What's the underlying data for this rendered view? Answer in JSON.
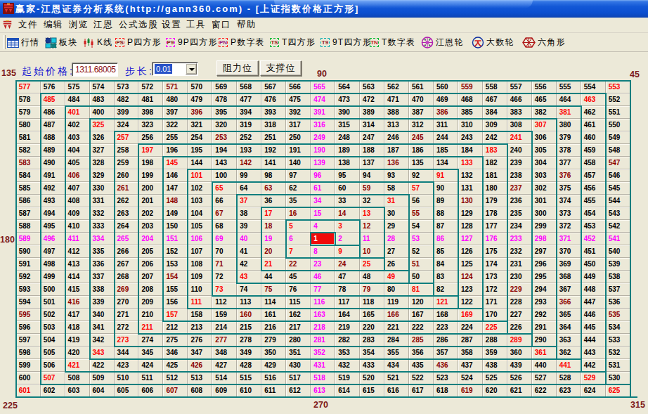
{
  "window": {
    "title": "赢家-江恩证券分析系统(http://gann360.com) - [上证指数价格正方形]"
  },
  "menu": {
    "items": [
      "文件",
      "编辑",
      "浏览",
      "江恩",
      "公式选股",
      "设置",
      "工具",
      "窗口",
      "帮助"
    ]
  },
  "toolbar": {
    "items": [
      {
        "icon": "quotes-grid-icon",
        "label": "行情"
      },
      {
        "icon": "blocks-icon",
        "label": "板块"
      },
      {
        "icon": "candlestick-icon",
        "label": "K线"
      },
      {
        "icon": "ps-badge-icon",
        "badge": "PS",
        "label": "P四方形"
      },
      {
        "icon": "p9-badge-icon",
        "badge": "P9",
        "label": "9P四方形"
      },
      {
        "icon": "pn-badge-icon",
        "badge": "PN",
        "label": "P数字表"
      },
      {
        "icon": "ts-badge-icon",
        "badge": "TS",
        "label": "T四方形"
      },
      {
        "icon": "t9-badge-icon",
        "badge": "T9",
        "label": "9T四方形"
      },
      {
        "icon": "tn-badge-icon",
        "badge": "TN",
        "label": "T数字表"
      },
      {
        "icon": "gann-wheel-icon",
        "label": "江恩轮"
      },
      {
        "icon": "big-number-wheel-icon",
        "label": "大数轮"
      },
      {
        "icon": "hexagon-icon",
        "label": "六角形"
      }
    ]
  },
  "controls": {
    "start_price_label": "起始价格:",
    "start_price_value": "1311.68005",
    "step_label": "步长:",
    "step_value": "0.01",
    "resistance_button": "阻力位",
    "support_button": "支撑位"
  },
  "angle_labels": {
    "top_left": "135",
    "top_center": "90",
    "top_right": "45",
    "left": "180",
    "bottom_left": "225",
    "bottom_center": "270",
    "bottom_right": "315"
  },
  "gann_square": {
    "type": "table",
    "size": 25,
    "center_value": 1,
    "max_value": 625,
    "highlight": {
      "cardinal_color": "#FF00FF",
      "diagonal_color": "#FF0000",
      "gann_2x1_color": "#8B0000",
      "default_color": "#000000",
      "center_background": "#F10A0A",
      "ring_line_color": "#0E7E7E"
    },
    "rows": [
      [
        577,
        576,
        575,
        574,
        573,
        572,
        571,
        570,
        569,
        568,
        567,
        566,
        565,
        564,
        563,
        562,
        561,
        560,
        559,
        558,
        557,
        556,
        555,
        554,
        553
      ],
      [
        578,
        485,
        484,
        483,
        482,
        481,
        480,
        479,
        478,
        477,
        476,
        475,
        474,
        473,
        472,
        471,
        470,
        469,
        468,
        467,
        466,
        465,
        464,
        463,
        552
      ],
      [
        579,
        486,
        401,
        400,
        399,
        398,
        397,
        396,
        395,
        394,
        393,
        392,
        391,
        390,
        389,
        388,
        387,
        386,
        385,
        384,
        383,
        382,
        381,
        462,
        551
      ],
      [
        580,
        487,
        402,
        325,
        324,
        323,
        322,
        321,
        320,
        319,
        318,
        317,
        316,
        315,
        314,
        313,
        312,
        311,
        310,
        309,
        308,
        307,
        380,
        461,
        550
      ],
      [
        581,
        488,
        403,
        326,
        257,
        256,
        255,
        254,
        253,
        252,
        251,
        250,
        249,
        248,
        247,
        246,
        245,
        244,
        243,
        242,
        241,
        306,
        379,
        460,
        549
      ],
      [
        582,
        489,
        404,
        327,
        258,
        197,
        196,
        195,
        194,
        193,
        192,
        191,
        190,
        189,
        188,
        187,
        186,
        185,
        184,
        183,
        240,
        305,
        378,
        459,
        548
      ],
      [
        583,
        490,
        405,
        328,
        259,
        198,
        145,
        144,
        143,
        142,
        141,
        140,
        139,
        138,
        137,
        136,
        135,
        134,
        133,
        182,
        239,
        304,
        377,
        458,
        547
      ],
      [
        584,
        491,
        406,
        329,
        260,
        199,
        146,
        101,
        100,
        99,
        98,
        97,
        96,
        95,
        94,
        93,
        92,
        91,
        132,
        181,
        238,
        303,
        376,
        457,
        546
      ],
      [
        585,
        492,
        407,
        330,
        261,
        200,
        147,
        102,
        65,
        64,
        63,
        62,
        61,
        60,
        59,
        58,
        57,
        90,
        131,
        180,
        237,
        302,
        375,
        456,
        545
      ],
      [
        586,
        493,
        408,
        331,
        262,
        201,
        148,
        103,
        66,
        37,
        36,
        35,
        34,
        33,
        32,
        31,
        56,
        89,
        130,
        179,
        236,
        301,
        374,
        455,
        544
      ],
      [
        587,
        494,
        409,
        332,
        263,
        202,
        149,
        104,
        67,
        38,
        17,
        16,
        15,
        14,
        13,
        30,
        55,
        88,
        129,
        178,
        235,
        300,
        373,
        454,
        543
      ],
      [
        588,
        495,
        410,
        333,
        264,
        203,
        150,
        105,
        68,
        39,
        18,
        5,
        4,
        3,
        12,
        29,
        54,
        87,
        128,
        177,
        234,
        299,
        372,
        453,
        542
      ],
      [
        589,
        496,
        411,
        334,
        265,
        204,
        151,
        106,
        69,
        40,
        19,
        6,
        1,
        2,
        11,
        28,
        53,
        86,
        127,
        176,
        233,
        298,
        371,
        452,
        541
      ],
      [
        590,
        497,
        412,
        335,
        266,
        205,
        152,
        107,
        70,
        41,
        20,
        7,
        8,
        9,
        10,
        27,
        52,
        85,
        126,
        175,
        232,
        297,
        370,
        451,
        540
      ],
      [
        591,
        498,
        413,
        336,
        267,
        206,
        153,
        108,
        71,
        42,
        21,
        22,
        23,
        24,
        25,
        26,
        51,
        84,
        125,
        174,
        231,
        296,
        369,
        450,
        539
      ],
      [
        592,
        499,
        414,
        337,
        268,
        207,
        154,
        109,
        72,
        43,
        44,
        45,
        46,
        47,
        48,
        49,
        50,
        83,
        124,
        173,
        230,
        295,
        368,
        449,
        538
      ],
      [
        593,
        500,
        415,
        338,
        269,
        208,
        155,
        110,
        73,
        74,
        75,
        76,
        77,
        78,
        79,
        80,
        81,
        82,
        123,
        172,
        229,
        294,
        367,
        448,
        537
      ],
      [
        594,
        501,
        416,
        339,
        270,
        209,
        156,
        111,
        112,
        113,
        114,
        115,
        116,
        117,
        118,
        119,
        120,
        121,
        122,
        171,
        228,
        293,
        366,
        447,
        536
      ],
      [
        595,
        502,
        417,
        340,
        271,
        210,
        157,
        158,
        159,
        160,
        161,
        162,
        163,
        164,
        165,
        166,
        167,
        168,
        169,
        170,
        227,
        292,
        365,
        446,
        535
      ],
      [
        596,
        503,
        418,
        341,
        272,
        211,
        212,
        213,
        214,
        215,
        216,
        217,
        218,
        219,
        220,
        221,
        222,
        223,
        224,
        225,
        226,
        291,
        364,
        445,
        534
      ],
      [
        597,
        504,
        419,
        342,
        273,
        274,
        275,
        276,
        277,
        278,
        279,
        280,
        281,
        282,
        283,
        284,
        285,
        286,
        287,
        288,
        289,
        290,
        363,
        444,
        533
      ],
      [
        598,
        505,
        420,
        343,
        344,
        345,
        346,
        347,
        348,
        349,
        350,
        351,
        352,
        353,
        354,
        355,
        356,
        357,
        358,
        359,
        360,
        361,
        362,
        443,
        532
      ],
      [
        599,
        506,
        421,
        422,
        423,
        424,
        425,
        426,
        427,
        428,
        429,
        430,
        431,
        432,
        433,
        434,
        435,
        436,
        437,
        438,
        439,
        440,
        441,
        442,
        531
      ],
      [
        600,
        507,
        508,
        509,
        510,
        511,
        512,
        513,
        514,
        515,
        516,
        517,
        518,
        519,
        520,
        521,
        522,
        523,
        524,
        525,
        526,
        527,
        528,
        529,
        530
      ],
      [
        601,
        602,
        603,
        604,
        605,
        606,
        607,
        608,
        609,
        610,
        611,
        612,
        613,
        614,
        615,
        616,
        617,
        618,
        619,
        620,
        621,
        622,
        623,
        624,
        625
      ]
    ]
  }
}
